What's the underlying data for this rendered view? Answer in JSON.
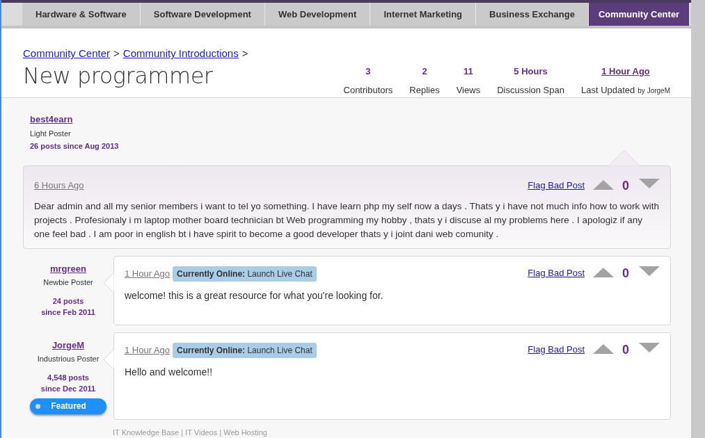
{
  "nav_tabs": [
    {
      "label": "Hardware & Software",
      "selected": false
    },
    {
      "label": "Software Development",
      "selected": false
    },
    {
      "label": "Web Development",
      "selected": false
    },
    {
      "label": "Internet Marketing",
      "selected": false
    },
    {
      "label": "Business Exchange",
      "selected": false
    },
    {
      "label": "Community Center",
      "selected": true
    }
  ],
  "breadcrumb": [
    "Community Center",
    "Community Introductions"
  ],
  "breadcrumb_separator": ">",
  "title": "New programmer",
  "stats": [
    {
      "kind": "plain",
      "value": "3",
      "label": "Contributors"
    },
    {
      "kind": "plain",
      "value": "2",
      "label": "Replies"
    },
    {
      "kind": "plain",
      "value": "11",
      "label": "Views"
    },
    {
      "kind": "plain",
      "value": "5 Hours",
      "label": "Discussion Span"
    },
    {
      "kind": "link",
      "value": "1 Hour Ago",
      "label": "Last Updated",
      "byline": "by JorgeM"
    }
  ],
  "posts": [
    {
      "kind": "original",
      "author": "best4earn",
      "rank": "Light Poster",
      "post_count": "26 posts since Aug 2013",
      "time": "6 Hours Ago",
      "text": "Dear admin and all my senior members i want to tel yo something. I have learn php my self now a days . Thats y i have not much info how to work with projects . Profesionaly i m laptop mother board technician bt Web programming my hobby , thats y i discuse al my problems here . I apologiz if any one feel bad . I am poor in english bt i have spirit to become a good developer thats y i joint dani web comunity .",
      "flag": "Flag Bad Post",
      "score": "0"
    },
    {
      "kind": "reply",
      "author": "mrgreen",
      "rank": "Newbie Poster",
      "post_count": "24 posts",
      "post_since": "since Feb 2011",
      "time": "1 Hour Ago",
      "online_label": "Currently Online:",
      "online_action": "Launch Live Chat",
      "text": "welcome! this is a great resource for what you're looking for.",
      "flag": "Flag Bad Post",
      "score": "0"
    },
    {
      "kind": "reply",
      "author": "JorgeM",
      "rank": "Industrious Poster",
      "post_count": "4,548 posts",
      "post_since": "since Dec 2011",
      "featured": "Featured",
      "time": "1 Hour Ago",
      "online_label": "Currently Online:",
      "online_action": "Launch Live Chat",
      "text": "Hello and welcome!!",
      "flag": "Flag Bad Post",
      "score": "0"
    }
  ],
  "footer_links": "IT Knowledge Base | IT Videos | Web Hosting"
}
